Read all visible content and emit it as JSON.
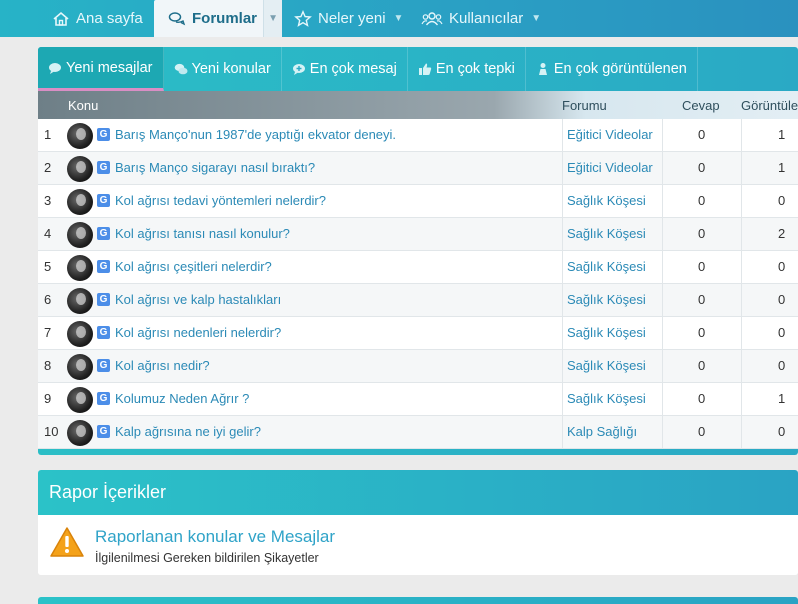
{
  "nav": {
    "home_label": "Ana sayfa",
    "forums_label": "Forumlar",
    "whats_new_label": "Neler yeni",
    "members_label": "Kullanıcılar"
  },
  "tabs": [
    {
      "label": "Yeni mesajlar"
    },
    {
      "label": "Yeni konular"
    },
    {
      "label": "En çok mesaj"
    },
    {
      "label": "En çok tepki"
    },
    {
      "label": "En çok görüntülenen"
    }
  ],
  "table": {
    "col_topic": "Konu",
    "col_forum": "Forumu",
    "col_replies": "Cevap",
    "col_views": "Görüntüle",
    "rows": [
      {
        "num": "1",
        "title": "Barış Manço'nun 1987'de yaptığı ekvator deneyi.",
        "forum": "Eğitici Videolar",
        "replies": "0",
        "views": "1"
      },
      {
        "num": "2",
        "title": "Barış Manço sigarayı nasıl bıraktı?",
        "forum": "Eğitici Videolar",
        "replies": "0",
        "views": "1"
      },
      {
        "num": "3",
        "title": "Kol ağrısı tedavi yöntemleri nelerdir?",
        "forum": "Sağlık Köşesi",
        "replies": "0",
        "views": "0"
      },
      {
        "num": "4",
        "title": "Kol ağrısı tanısı nasıl konulur?",
        "forum": "Sağlık Köşesi",
        "replies": "0",
        "views": "2"
      },
      {
        "num": "5",
        "title": "Kol ağrısı çeşitleri nelerdir?",
        "forum": "Sağlık Köşesi",
        "replies": "0",
        "views": "0"
      },
      {
        "num": "6",
        "title": "Kol ağrısı ve kalp hastalıkları",
        "forum": "Sağlık Köşesi",
        "replies": "0",
        "views": "0"
      },
      {
        "num": "7",
        "title": "Kol ağrısı nedenleri nelerdir?",
        "forum": "Sağlık Köşesi",
        "replies": "0",
        "views": "0"
      },
      {
        "num": "8",
        "title": "Kol ağrısı nedir?",
        "forum": "Sağlık Köşesi",
        "replies": "0",
        "views": "0"
      },
      {
        "num": "9",
        "title": "Kolumuz Neden Ağrır ?",
        "forum": "Sağlık Köşesi",
        "replies": "0",
        "views": "1"
      },
      {
        "num": "10",
        "title": "Kalp ağrısına ne iyi gelir?",
        "forum": "Kalp Sağlığı",
        "replies": "0",
        "views": "0"
      }
    ],
    "prefix_icon": "G"
  },
  "report": {
    "heading": "Rapor İçerikler",
    "title": "Raporlanan konular ve Mesajlar",
    "description": "İlgilenilmesi Gereken bildirilen Şikayetler"
  },
  "colors": {
    "accent": "#2aa9c5",
    "link": "#2b8ab6",
    "active_tab_underline": "#d98ec5"
  }
}
